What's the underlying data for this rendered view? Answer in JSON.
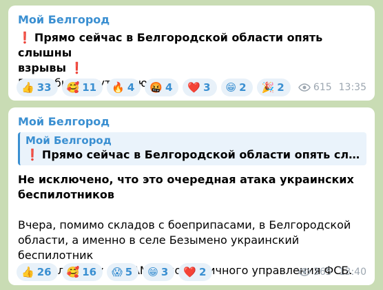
{
  "messages": [
    {
      "sender": "Мой Белгород",
      "excl1": "❗",
      "headline": "Прямо сейчас в Белгородской области опять слышны",
      "headline2": "взрывы",
      "excl2": "❗",
      "text": "Подробности уточняются.",
      "reactions": [
        {
          "emoji": "👍",
          "count": "33"
        },
        {
          "emoji": "🥰",
          "count": "11"
        },
        {
          "emoji": "🔥",
          "count": "4"
        },
        {
          "emoji": "🤬",
          "count": "4"
        },
        {
          "emoji": "❤️",
          "count": "3"
        },
        {
          "emoji": "😁",
          "count": "2"
        },
        {
          "emoji": "🎉",
          "count": "2"
        }
      ],
      "views": "615",
      "time": "13:35"
    },
    {
      "sender": "Мой Белгород",
      "reply": {
        "sender": "Мой Белгород",
        "excl": "❗",
        "text": "Прямо сейчас в Белгородской области опять слышны в..."
      },
      "bold_line1": "Не исключено, что это очередная атака украинских",
      "bold_line2": "беспилотников",
      "body_line1": "Вчера, помимо складов с боеприпасами, в Белгородской",
      "body_line2": "области, а именно в селе Безымено украинский беспилотник",
      "body_line3": "сбросил бомбу на КАМАЗ пограничного управления ФСБ.",
      "reactions": [
        {
          "emoji": "👍",
          "count": "26"
        },
        {
          "emoji": "🥰",
          "count": "16"
        },
        {
          "emoji": "😱",
          "count": "5"
        },
        {
          "emoji": "😁",
          "count": "3"
        },
        {
          "emoji": "❤️",
          "count": "2"
        }
      ],
      "views": "365",
      "time": "13:40"
    }
  ],
  "colors": {
    "accent": "#3a8fd1",
    "background": "#c9dcb4",
    "alert": "#d7192a"
  }
}
